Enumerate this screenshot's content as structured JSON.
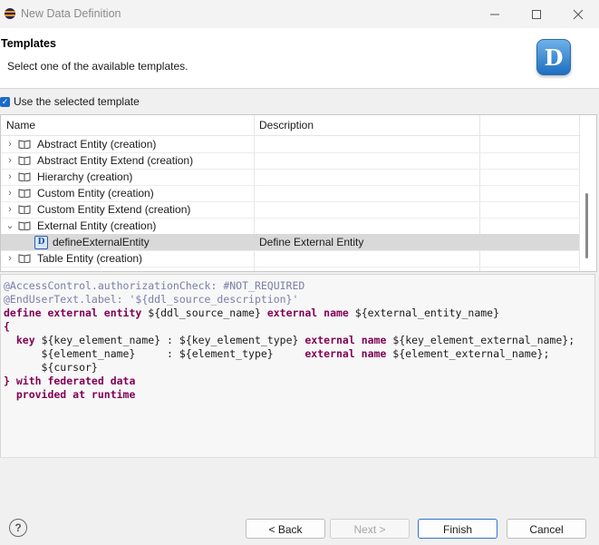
{
  "window": {
    "title": "New Data Definition",
    "controls": [
      "minimize-icon",
      "maximize-icon",
      "close-icon"
    ]
  },
  "header": {
    "title": "Templates",
    "subtitle": "Select one of the available templates.",
    "logo_letter": "D"
  },
  "use_template": {
    "label": "Use the selected template",
    "checked": true
  },
  "table": {
    "columns": [
      "Name",
      "Description"
    ],
    "rows": [
      {
        "label": "Abstract Entity (creation)",
        "description": "",
        "expanded": false,
        "level": 0,
        "icon": "book-icon"
      },
      {
        "label": "Abstract Entity Extend (creation)",
        "description": "",
        "expanded": false,
        "level": 0,
        "icon": "book-icon"
      },
      {
        "label": "Hierarchy (creation)",
        "description": "",
        "expanded": false,
        "level": 0,
        "icon": "book-icon"
      },
      {
        "label": "Custom Entity (creation)",
        "description": "",
        "expanded": false,
        "level": 0,
        "icon": "book-icon"
      },
      {
        "label": "Custom Entity Extend (creation)",
        "description": "",
        "expanded": false,
        "level": 0,
        "icon": "book-icon"
      },
      {
        "label": "External Entity (creation)",
        "description": "",
        "expanded": true,
        "level": 0,
        "icon": "book-icon"
      },
      {
        "label": "defineExternalEntity",
        "description": "Define External Entity",
        "level": 1,
        "selected": true,
        "icon": "template-icon"
      },
      {
        "label": "Table Entity (creation)",
        "description": "",
        "expanded": false,
        "level": 0,
        "icon": "book-icon"
      }
    ]
  },
  "code_preview": [
    "@AccessControl.authorizationCheck: #NOT_REQUIRED",
    "@EndUserText.label: '${ddl_source_description}'",
    "define external entity ${ddl_source_name} external name ${external_entity_name}",
    "{",
    "  key ${key_element_name} : ${key_element_type} external name ${key_element_external_name};",
    "      ${element_name}     : ${element_type}     external name ${element_external_name};",
    "      ${cursor}",
    "} with federated data",
    "  provided at runtime"
  ],
  "buttons": {
    "help": "?",
    "back": "< Back",
    "next": "Next >",
    "finish": "Finish",
    "cancel": "Cancel"
  },
  "colors": {
    "accent": "#1b6ac9",
    "keyword": "#7f0055",
    "annotation": "#7b7ea8",
    "selection": "#d9d9d9"
  }
}
